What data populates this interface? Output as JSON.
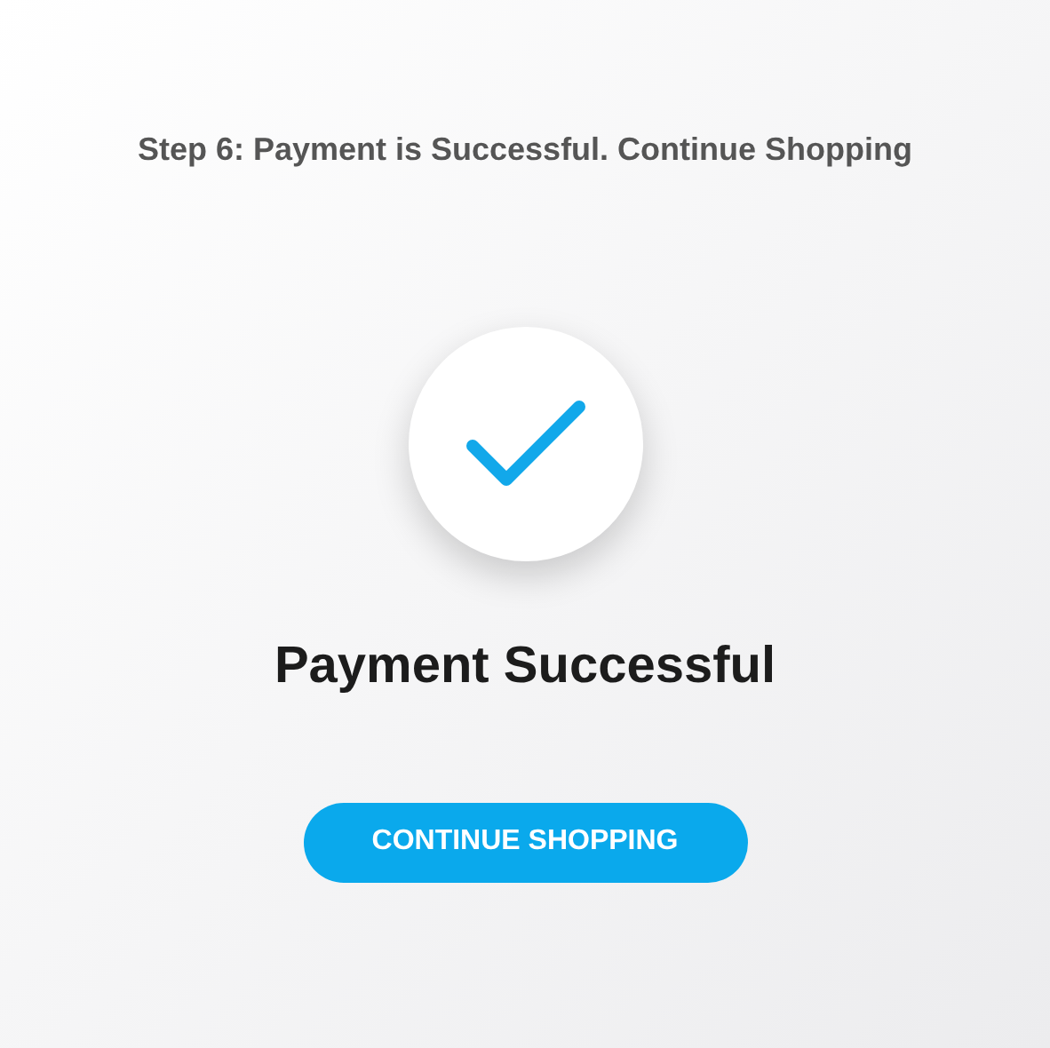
{
  "caption": "Step 6: Payment is Successful. Continue Shopping",
  "status": {
    "title": "Payment Successful"
  },
  "button": {
    "label": "CONTINUE SHOPPING"
  }
}
